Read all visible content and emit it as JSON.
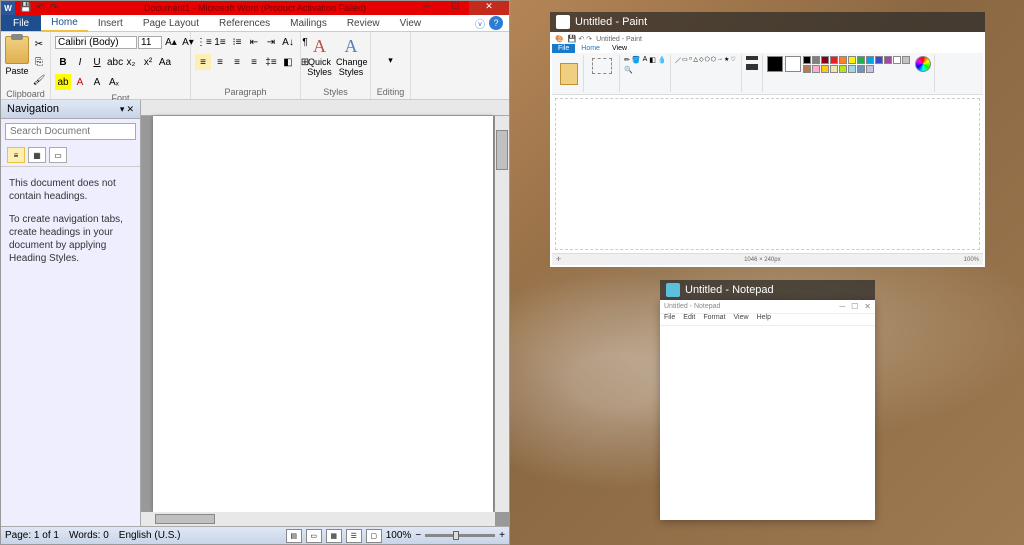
{
  "word": {
    "title": "Document1 - Microsoft Word (Product Activation Failed)",
    "tabs": {
      "file": "File",
      "home": "Home",
      "insert": "Insert",
      "page_layout": "Page Layout",
      "references": "References",
      "mailings": "Mailings",
      "review": "Review",
      "view": "View"
    },
    "ribbon": {
      "clipboard": {
        "paste": "Paste",
        "label": "Clipboard"
      },
      "font": {
        "name": "Calibri (Body)",
        "size": "11",
        "label": "Font"
      },
      "paragraph": {
        "label": "Paragraph"
      },
      "styles": {
        "quick": "Quick Styles",
        "change": "Change Styles",
        "label": "Styles"
      },
      "editing": {
        "label": "Editing"
      }
    },
    "nav": {
      "title": "Navigation",
      "search_placeholder": "Search Document",
      "msg1": "This document does not contain headings.",
      "msg2": "To create navigation tabs, create headings in your document by applying Heading Styles."
    },
    "status": {
      "page": "Page: 1 of 1",
      "words": "Words: 0",
      "lang": "English (U.S.)",
      "zoom": "100%"
    }
  },
  "paint": {
    "thumb_title": "Untitled - Paint",
    "titlebar": "Untitled - Paint",
    "file": "File",
    "tabs": {
      "home": "Home",
      "view": "View"
    },
    "status": {
      "size": "1046 × 240px",
      "zoom": "100%"
    },
    "colors": [
      "#000000",
      "#7f7f7f",
      "#880015",
      "#ed1c24",
      "#ff7f27",
      "#fff200",
      "#22b14c",
      "#00a2e8",
      "#3f48cc",
      "#a349a4",
      "#ffffff",
      "#c3c3c3",
      "#b97a57",
      "#ffaec9",
      "#ffc90e",
      "#efe4b0",
      "#b5e61d",
      "#99d9ea",
      "#7092be",
      "#c8bfe7"
    ]
  },
  "notepad": {
    "thumb_title": "Untitled - Notepad",
    "titlebar": "Untitled - Notepad",
    "menu": {
      "file": "File",
      "edit": "Edit",
      "format": "Format",
      "view": "View",
      "help": "Help"
    }
  }
}
